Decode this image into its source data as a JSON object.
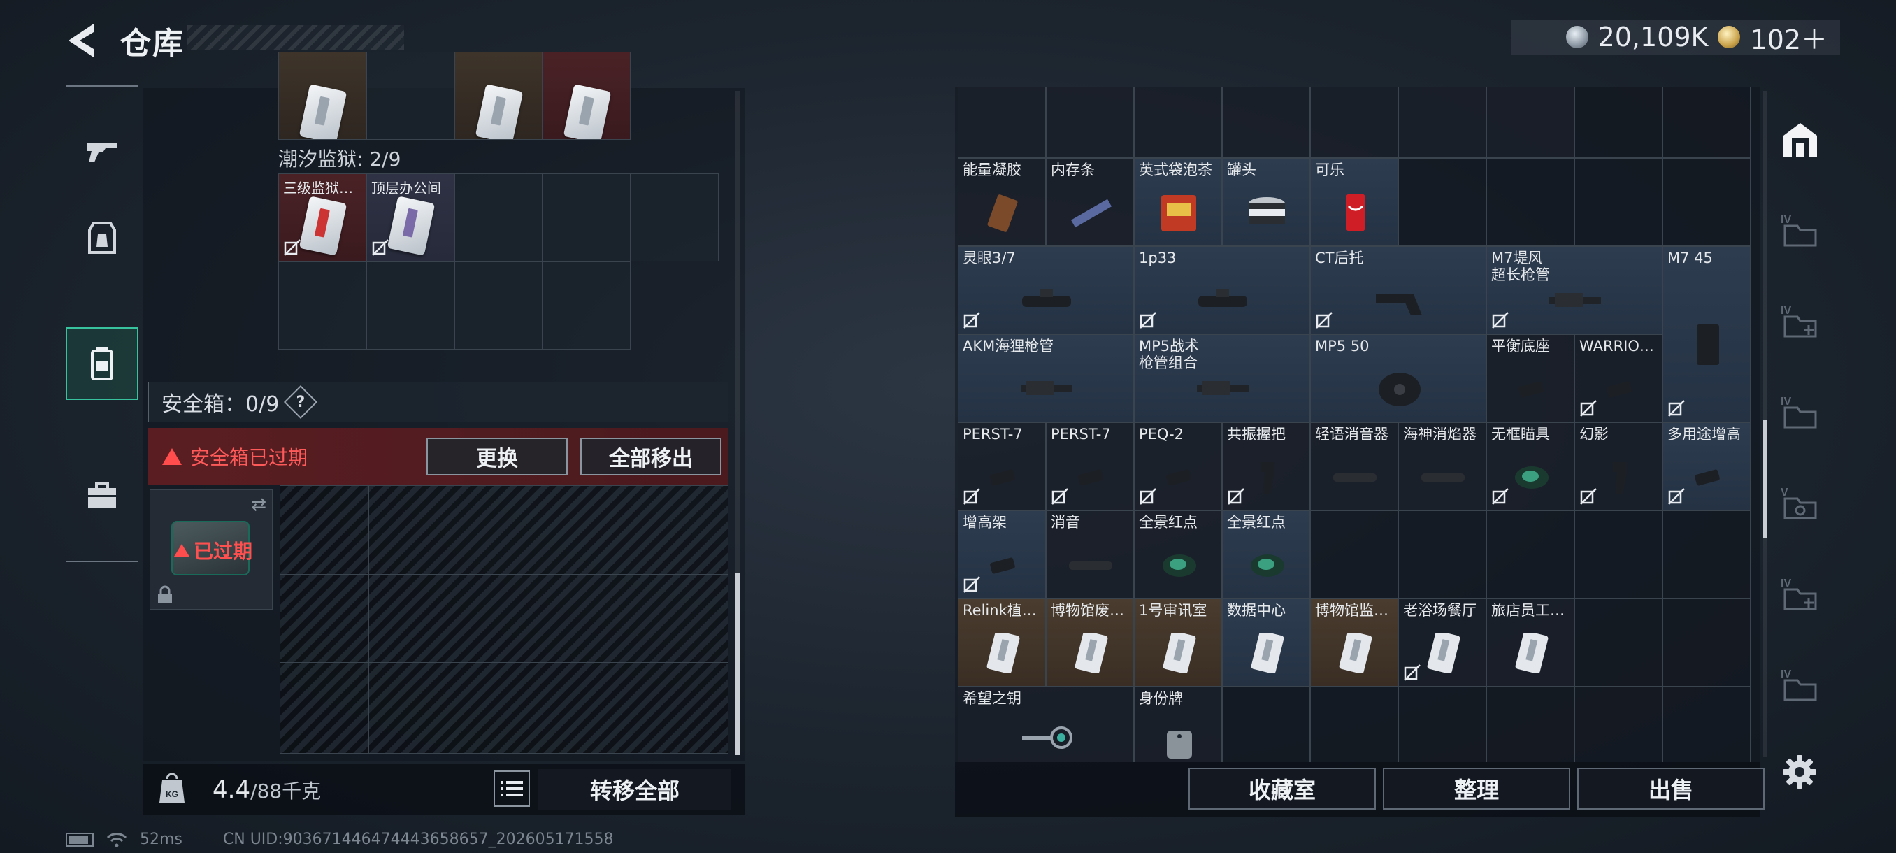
{
  "header": {
    "title": "仓库"
  },
  "currency": {
    "silver": "20,109K",
    "gold": "102＋"
  },
  "left": {
    "tide_prison": "潮汐监狱: 2/9",
    "tide_cells": [
      {
        "label": "三级监狱…",
        "tone": "red",
        "card": "red"
      },
      {
        "label": "顶层办公间",
        "tone": "",
        "card": "purple"
      }
    ],
    "safebox_label": "安全箱：0/9",
    "help": "?",
    "expired_banner": "安全箱已过期",
    "swap_btn": "更换",
    "removeall_btn": "全部移出",
    "box_expired": "已过期"
  },
  "weight": {
    "value": "4.4",
    "max": "/88千克",
    "kg_icon": "KG"
  },
  "transfer_all": "转移全部",
  "status": {
    "ping": "52ms",
    "uid": "CN UID:903671446474443658657_202605171558"
  },
  "right_rows": [
    [
      {
        "label": "能量凝胶",
        "tone": "",
        "icon": "bar"
      },
      {
        "label": "内存条",
        "tone": "",
        "icon": "stick"
      },
      {
        "label": "英式袋泡茶",
        "tone": "blue",
        "icon": "tin"
      },
      {
        "label": "罐头",
        "tone": "blue",
        "icon": "can"
      },
      {
        "label": "可乐",
        "tone": "blue",
        "icon": "cola"
      }
    ],
    [
      {
        "label": "灵眼3/7",
        "tone": "blue",
        "icon": "scope",
        "w": 2
      },
      {
        "label": "1p33",
        "tone": "blue",
        "icon": "scope",
        "w": 2
      },
      {
        "label": "CT后托",
        "tone": "blue",
        "icon": "stock",
        "w": 2
      },
      {
        "label": "M7堤风\n超长枪管",
        "tone": "blue",
        "icon": "barrel",
        "w": 2
      },
      {
        "label": "M7 45",
        "tone": "blue",
        "icon": "mag",
        "tall": true
      }
    ],
    [
      {
        "label": "AKM海狸枪管",
        "tone": "blue",
        "icon": "barrel",
        "w": 2
      },
      {
        "label": "MP5战术\n枪管组合",
        "tone": "blue",
        "icon": "barrel",
        "w": 2
      },
      {
        "label": "MP5 50",
        "tone": "blue",
        "icon": "drum",
        "w": 2
      },
      {
        "label": "平衡底座",
        "tone": "",
        "icon": "small"
      },
      {
        "label": "WARRIO…",
        "tone": "",
        "icon": "small"
      }
    ],
    [
      {
        "label": "PERST-7",
        "tone": "",
        "icon": "small"
      },
      {
        "label": "PERST-7",
        "tone": "",
        "icon": "small"
      },
      {
        "label": "PEQ-2",
        "tone": "",
        "icon": "small"
      },
      {
        "label": "共振握把",
        "tone": "",
        "icon": "grip"
      },
      {
        "label": "轻语消音器",
        "tone": "",
        "icon": "supp"
      },
      {
        "label": "海神消焰器",
        "tone": "",
        "icon": "supp"
      },
      {
        "label": "无框瞄具",
        "tone": "",
        "icon": "sight"
      },
      {
        "label": "幻影",
        "tone": "",
        "icon": "grip"
      },
      {
        "label": "多用途增高",
        "tone": "blue",
        "icon": "small"
      }
    ],
    [
      {
        "label": "增高架",
        "tone": "blue",
        "icon": "small"
      },
      {
        "label": "消音",
        "tone": "",
        "icon": "supp"
      },
      {
        "label": "全景红点",
        "tone": "",
        "icon": "sight"
      },
      {
        "label": "全景红点",
        "tone": "blue",
        "icon": "sight"
      }
    ],
    [
      {
        "label": "Relink植…",
        "tone": "brown",
        "icon": "card"
      },
      {
        "label": "博物馆废…",
        "tone": "brown",
        "icon": "card"
      },
      {
        "label": "1号审讯室",
        "tone": "brown",
        "icon": "card"
      },
      {
        "label": "数据中心",
        "tone": "blue",
        "icon": "card"
      },
      {
        "label": "博物馆监…",
        "tone": "brown",
        "icon": "card"
      },
      {
        "label": "老浴场餐厅",
        "tone": "",
        "icon": "card"
      },
      {
        "label": "旅店员工…",
        "tone": "",
        "icon": "card"
      }
    ],
    [
      {
        "label": "希望之钥",
        "tone": "",
        "icon": "key",
        "w": 2
      },
      {
        "label": "身份牌",
        "tone": "",
        "icon": "tag"
      }
    ]
  ],
  "bottom_buttons": {
    "collection": "收藏室",
    "sort": "整理",
    "sell": "出售"
  }
}
